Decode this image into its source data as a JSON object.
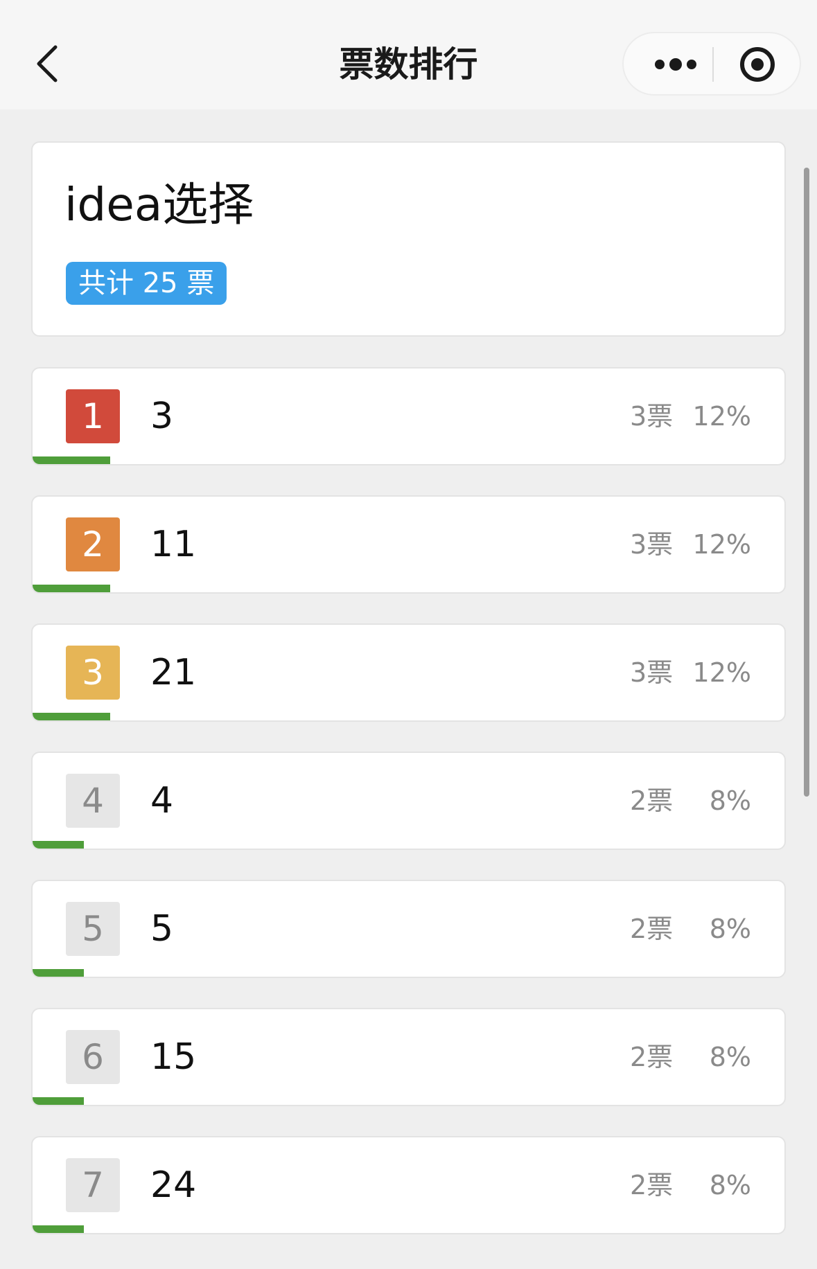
{
  "nav": {
    "title": "票数排行"
  },
  "poll": {
    "title": "idea选择",
    "total_label": "共计 25 票"
  },
  "colors": {
    "rank1": "#d14a3b",
    "rank2": "#e08840",
    "rank3": "#e6b556",
    "rank_other": "#e6e6e6",
    "bar": "#4f9e3a",
    "total_badge": "#3aa0ea"
  },
  "rankings": [
    {
      "rank": "1",
      "name": "3",
      "votes": "3票",
      "percent": "12%",
      "share": 0.12
    },
    {
      "rank": "2",
      "name": "11",
      "votes": "3票",
      "percent": "12%",
      "share": 0.12
    },
    {
      "rank": "3",
      "name": "21",
      "votes": "3票",
      "percent": "12%",
      "share": 0.12
    },
    {
      "rank": "4",
      "name": "4",
      "votes": "2票",
      "percent": "8%",
      "share": 0.08
    },
    {
      "rank": "5",
      "name": "5",
      "votes": "2票",
      "percent": "8%",
      "share": 0.08
    },
    {
      "rank": "6",
      "name": "15",
      "votes": "2票",
      "percent": "8%",
      "share": 0.08
    },
    {
      "rank": "7",
      "name": "24",
      "votes": "2票",
      "percent": "8%",
      "share": 0.08
    }
  ]
}
